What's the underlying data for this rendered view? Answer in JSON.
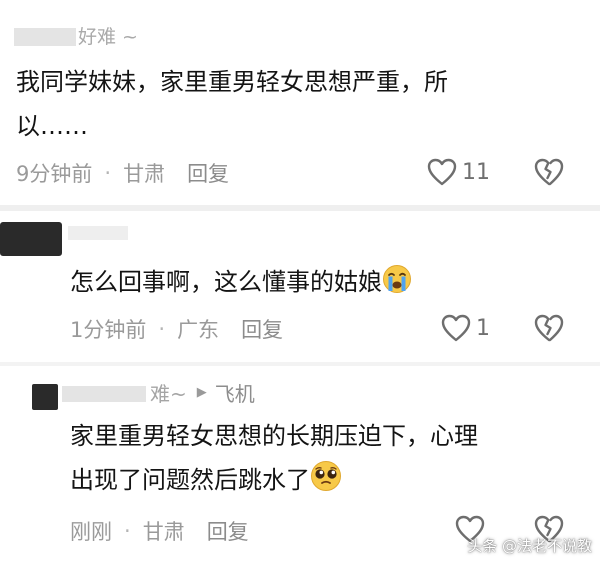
{
  "comments": [
    {
      "username_partial": "好难 ~",
      "text_line1": "我同学妹妹，家里重男轻女思想严重，所",
      "text_line2": "以……",
      "time": "9分钟前",
      "location": "甘肃",
      "reply_label": "回复",
      "likes": "11"
    },
    {
      "username_partial": "",
      "text": "怎么回事啊，这么懂事的姑娘",
      "emoji": "crying-face",
      "time": "1分钟前",
      "location": "广东",
      "reply_label": "回复",
      "likes": "1"
    },
    {
      "username_partial": "难~",
      "reply_arrow": "▶",
      "reply_to": "飞机",
      "text_line1": "家里重男轻女思想的长期压迫下，心理",
      "text_line2": "出现了问题然后跳水了",
      "emoji": "pleading-face",
      "time": "刚刚",
      "location": "甘肃",
      "reply_label": "回复",
      "likes": ""
    }
  ],
  "separator": "·",
  "watermark": "头条 @法老不说教",
  "colors": {
    "text": "#141414",
    "meta": "#9a9a9a",
    "emoji": "#f7c948"
  }
}
